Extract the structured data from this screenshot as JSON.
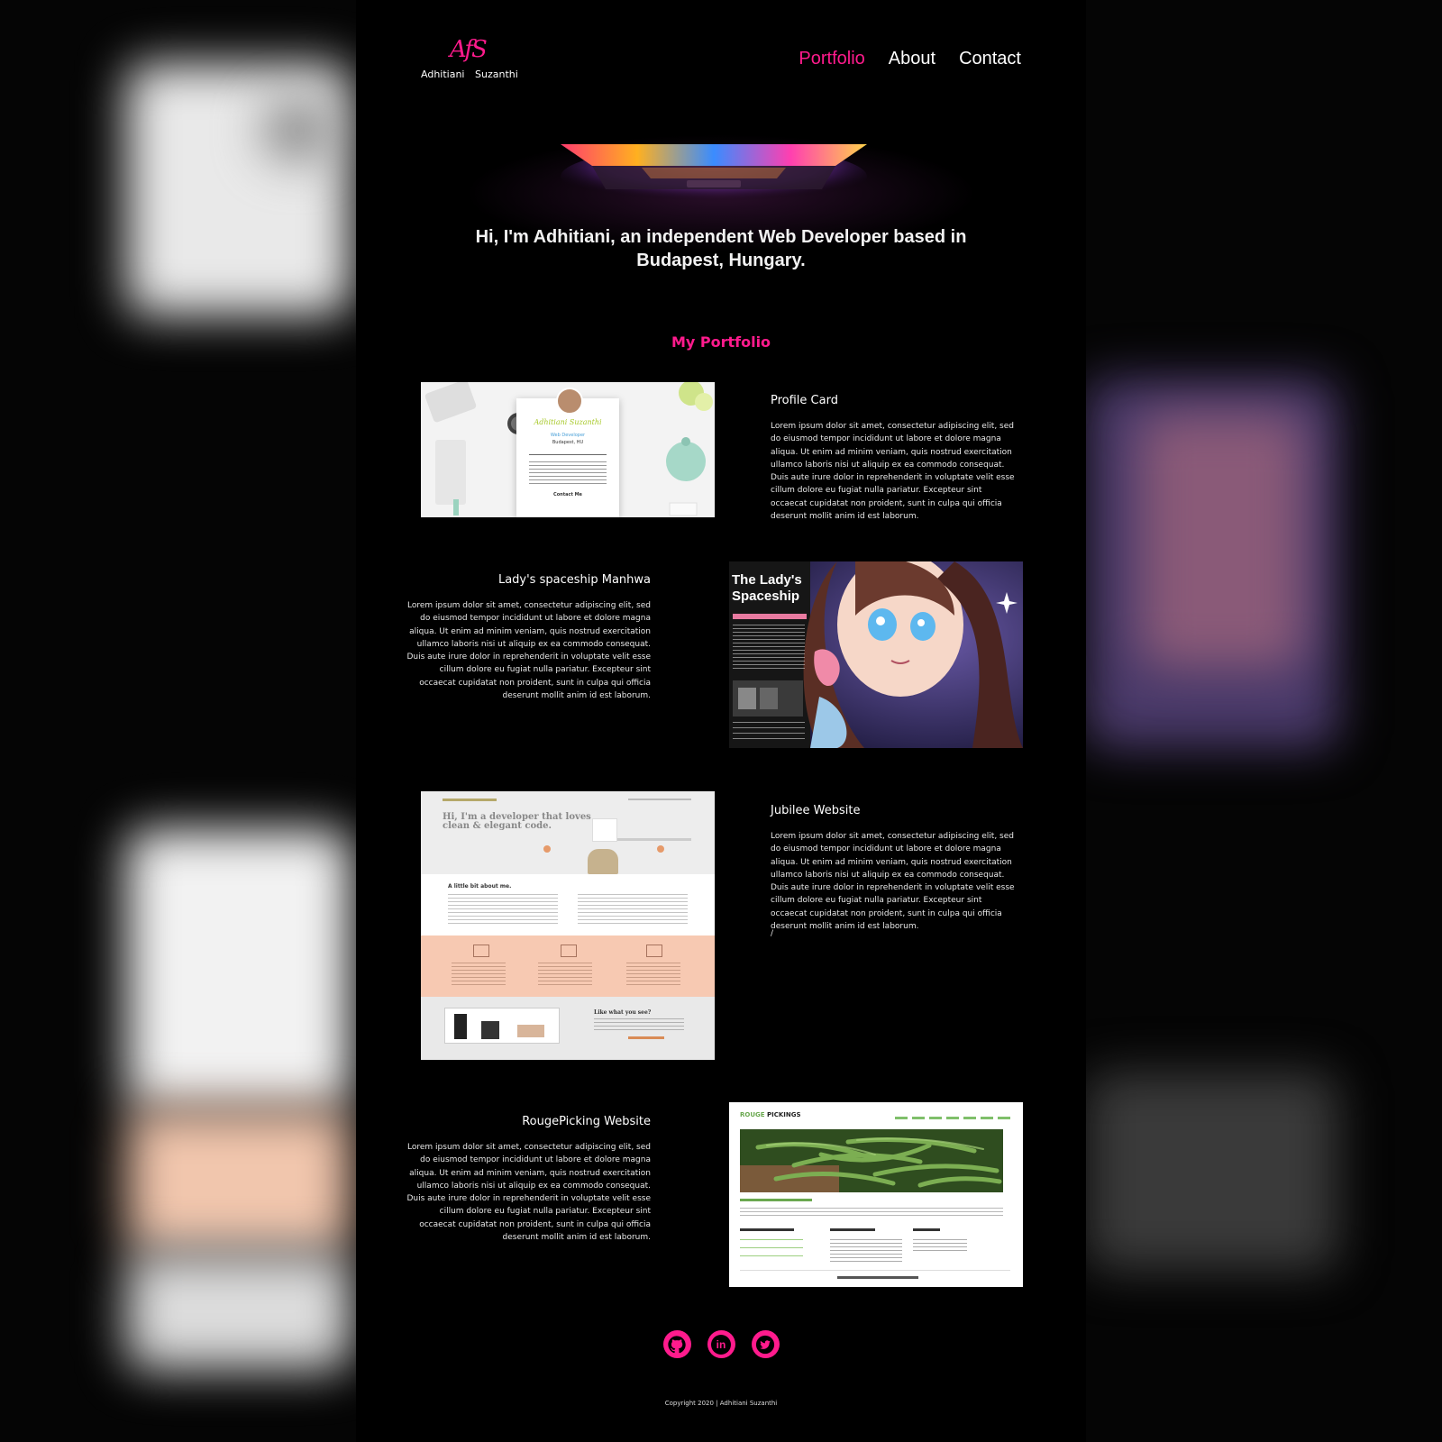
{
  "brand": {
    "monogram": "AfS",
    "first_name": "Adhitiani",
    "last_name": "Suzanthi"
  },
  "nav": {
    "items": [
      {
        "label": "Portfolio",
        "active": true
      },
      {
        "label": "About",
        "active": false
      },
      {
        "label": "Contact",
        "active": false
      }
    ]
  },
  "hero": {
    "line1": "Hi, I'm Adhitiani, an independent Web Developer based in",
    "line2": "Budapest, Hungary."
  },
  "portfolio": {
    "title": "My Portfolio",
    "projects": [
      {
        "title": "Profile Card",
        "description": "Lorem ipsum dolor sit amet, consectetur adipiscing elit, sed do eiusmod tempor incididunt ut labore et dolore magna aliqua. Ut enim ad minim veniam, quis nostrud exercitation ullamco laboris nisi ut aliquip ex ea commodo consequat. Duis aute irure dolor in reprehenderit in voluptate velit esse cillum dolore eu fugiat nulla pariatur. Excepteur sint occaecat cupidatat non proident, sunt in culpa qui officia deserunt mollit anim id est laborum.",
        "thumb": {
          "name": "Adhitiani Suzanthi",
          "role": "Web Developer",
          "location": "Budapest, HU",
          "contact": "Contact Me"
        }
      },
      {
        "title": "Lady's spaceship Manhwa",
        "description": "Lorem ipsum dolor sit amet, consectetur adipiscing elit, sed do eiusmod tempor incididunt ut labore et dolore magna aliqua. Ut enim ad minim veniam, quis nostrud exercitation ullamco laboris nisi ut aliquip ex ea commodo consequat. Duis aute irure dolor in reprehenderit in voluptate velit esse cillum dolore eu fugiat nulla pariatur. Excepteur sint occaecat cupidatat non proident, sunt in culpa qui officia deserunt mollit anim id est laborum.",
        "thumb": {
          "title_line1": "The Lady's",
          "title_line2": "Spaceship"
        }
      },
      {
        "title": "Jubilee Website",
        "description": "Lorem ipsum dolor sit amet, consectetur adipiscing elit, sed do eiusmod tempor incididunt ut labore et dolore magna aliqua. Ut enim ad minim veniam, quis nostrud exercitation ullamco laboris nisi ut aliquip ex ea commodo consequat. Duis aute irure dolor in reprehenderit in voluptate velit esse cillum dolore eu fugiat nulla pariatur. Excepteur sint occaecat cupidatat non proident, sunt in culpa qui officia deserunt mollit anim id est laborum.",
        "extra": "/",
        "thumb": {
          "headline1": "Hi, I'm a developer that loves",
          "headline2": "clean & elegant code.",
          "about": "A little bit about me.",
          "cta": "Like what you see?"
        }
      },
      {
        "title": "RougePicking Website",
        "description": "Lorem ipsum dolor sit amet, consectetur adipiscing elit, sed do eiusmod tempor incididunt ut labore et dolore magna aliqua. Ut enim ad minim veniam, quis nostrud exercitation ullamco laboris nisi ut aliquip ex ea commodo consequat. Duis aute irure dolor in reprehenderit in voluptate velit esse cillum dolore eu fugiat nulla pariatur. Excepteur sint occaecat cupidatat non proident, sunt in culpa qui officia deserunt mollit anim id est laborum.",
        "thumb": {
          "logo_a": "ROUGE",
          "logo_b": "PICKINGS"
        }
      }
    ]
  },
  "socials": [
    {
      "icon": "github-icon"
    },
    {
      "icon": "linkedin-icon",
      "glyph": "in"
    },
    {
      "icon": "twitter-icon"
    }
  ],
  "footer": {
    "copyright": "Copyright 2020 | Adhitiani Suzanthi"
  },
  "colors": {
    "accent": "#ff1b8d",
    "background": "#000000",
    "text": "#ffffff"
  }
}
